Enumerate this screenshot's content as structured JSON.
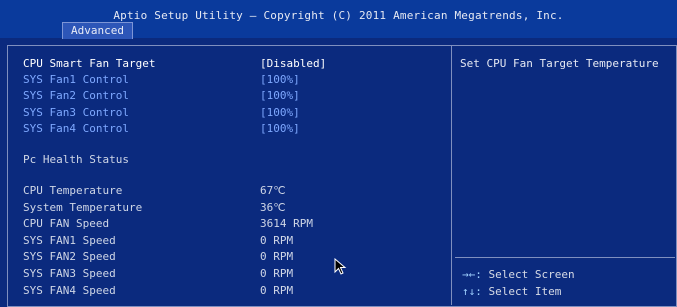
{
  "header": {
    "title": "Aptio Setup Utility – Copyright (C) 2011 American Megatrends, Inc.",
    "tab_advanced": "Advanced"
  },
  "settings": [
    {
      "label": "CPU Smart Fan Target",
      "value": "[Disabled]"
    },
    {
      "label": "SYS Fan1 Control",
      "value": "[100%]"
    },
    {
      "label": "SYS Fan2 Control",
      "value": "[100%]"
    },
    {
      "label": "SYS Fan3 Control",
      "value": "[100%]"
    },
    {
      "label": "SYS Fan4 Control",
      "value": "[100%]"
    }
  ],
  "section": {
    "pc_health": "Pc Health Status"
  },
  "health": [
    {
      "label": "CPU Temperature",
      "value": "67℃"
    },
    {
      "label": "System Temperature",
      "value": "36℃"
    },
    {
      "label": "CPU FAN Speed",
      "value": "3614 RPM"
    },
    {
      "label": "SYS FAN1 Speed",
      "value": "0 RPM"
    },
    {
      "label": "SYS FAN2 Speed",
      "value": "0 RPM"
    },
    {
      "label": "SYS FAN3 Speed",
      "value": "0 RPM"
    },
    {
      "label": "SYS FAN4 Speed",
      "value": "0 RPM"
    }
  ],
  "help": {
    "text": "Set CPU Fan Target Temperature",
    "keys": [
      {
        "key": "→←:",
        "desc": " Select Screen"
      },
      {
        "key": "↑↓:",
        "desc": " Select Item"
      }
    ]
  },
  "colors": {
    "background": "#0b2a7e",
    "link": "#7ea8ff",
    "highlight": "#ffffff"
  },
  "icons": {
    "cursor": "mouse-pointer-icon"
  }
}
